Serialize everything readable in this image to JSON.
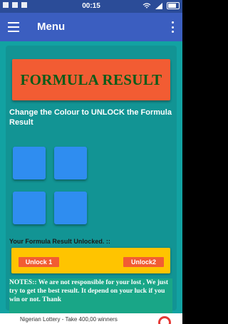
{
  "status_bar": {
    "time": "00:15"
  },
  "app_bar": {
    "title": "Menu"
  },
  "result_box": {
    "text": "FORMULA RESULT"
  },
  "instruction": {
    "text": "Change the Colour to  UNLOCK the Formula Result"
  },
  "unlocked_label": {
    "text": "Your Formula Result Unlocked. ::"
  },
  "unlock_buttons": {
    "btn1": "Unlock 1",
    "btn2": "Unlock2"
  },
  "notes": {
    "text": "NOTES::  We are not responsible for your lost , We just try to get the best result. It depend on your luck if you win or not. Thank"
  },
  "ad": {
    "text": "Nigerian Lottery - Take 400,00 winners"
  },
  "colors": {
    "app_bar": "#3b5ec0",
    "content_bg": "#12a2a2",
    "result_box": "#f25c33",
    "result_text": "#0b5b18",
    "square": "#2f8df0",
    "yellow_bar": "#ffc400",
    "notes_bg": "#19a687"
  },
  "icons": [
    "wifi-icon",
    "signal-icon",
    "battery-icon",
    "menu-icon",
    "more-vert-icon"
  ]
}
